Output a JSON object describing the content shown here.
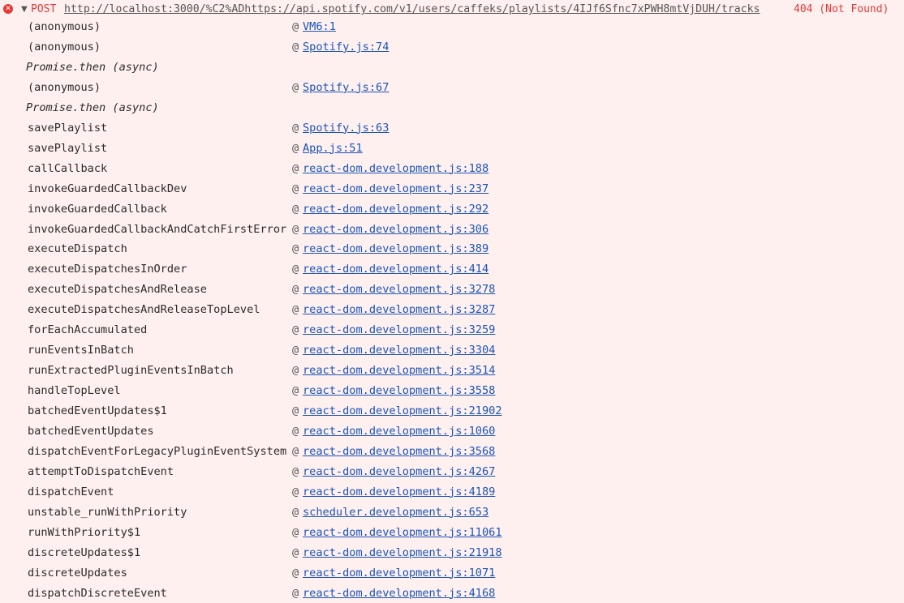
{
  "header": {
    "method": "POST",
    "url": "http://localhost:3000/%C2%ADhttps://api.spotify.com/v1/users/caffeks/playlists/4IJf6Sfnc7xPWH8mtVjDUH/tracks",
    "status": "404 (Not Found)",
    "error_icon": "error-x-icon",
    "expand_icon": "caret-down-icon"
  },
  "at_symbol": "@",
  "stack": [
    {
      "fn": "(anonymous)",
      "loc": "VM6:1"
    },
    {
      "fn": "(anonymous)",
      "loc": "Spotify.js:74"
    },
    {
      "fn": "Promise.then (async)",
      "async": true
    },
    {
      "fn": "(anonymous)",
      "loc": "Spotify.js:67"
    },
    {
      "fn": "Promise.then (async)",
      "async": true
    },
    {
      "fn": "savePlaylist",
      "loc": "Spotify.js:63"
    },
    {
      "fn": "savePlaylist",
      "loc": "App.js:51"
    },
    {
      "fn": "callCallback",
      "loc": "react-dom.development.js:188"
    },
    {
      "fn": "invokeGuardedCallbackDev",
      "loc": "react-dom.development.js:237"
    },
    {
      "fn": "invokeGuardedCallback",
      "loc": "react-dom.development.js:292"
    },
    {
      "fn": "invokeGuardedCallbackAndCatchFirstError",
      "loc": "react-dom.development.js:306"
    },
    {
      "fn": "executeDispatch",
      "loc": "react-dom.development.js:389"
    },
    {
      "fn": "executeDispatchesInOrder",
      "loc": "react-dom.development.js:414"
    },
    {
      "fn": "executeDispatchesAndRelease",
      "loc": "react-dom.development.js:3278"
    },
    {
      "fn": "executeDispatchesAndReleaseTopLevel",
      "loc": "react-dom.development.js:3287"
    },
    {
      "fn": "forEachAccumulated",
      "loc": "react-dom.development.js:3259"
    },
    {
      "fn": "runEventsInBatch",
      "loc": "react-dom.development.js:3304"
    },
    {
      "fn": "runExtractedPluginEventsInBatch",
      "loc": "react-dom.development.js:3514"
    },
    {
      "fn": "handleTopLevel",
      "loc": "react-dom.development.js:3558"
    },
    {
      "fn": "batchedEventUpdates$1",
      "loc": "react-dom.development.js:21902"
    },
    {
      "fn": "batchedEventUpdates",
      "loc": "react-dom.development.js:1060"
    },
    {
      "fn": "dispatchEventForLegacyPluginEventSystem",
      "loc": "react-dom.development.js:3568"
    },
    {
      "fn": "attemptToDispatchEvent",
      "loc": "react-dom.development.js:4267"
    },
    {
      "fn": "dispatchEvent",
      "loc": "react-dom.development.js:4189"
    },
    {
      "fn": "unstable_runWithPriority",
      "loc": "scheduler.development.js:653"
    },
    {
      "fn": "runWithPriority$1",
      "loc": "react-dom.development.js:11061"
    },
    {
      "fn": "discreteUpdates$1",
      "loc": "react-dom.development.js:21918"
    },
    {
      "fn": "discreteUpdates",
      "loc": "react-dom.development.js:1071"
    },
    {
      "fn": "dispatchDiscreteEvent",
      "loc": "react-dom.development.js:4168"
    }
  ]
}
